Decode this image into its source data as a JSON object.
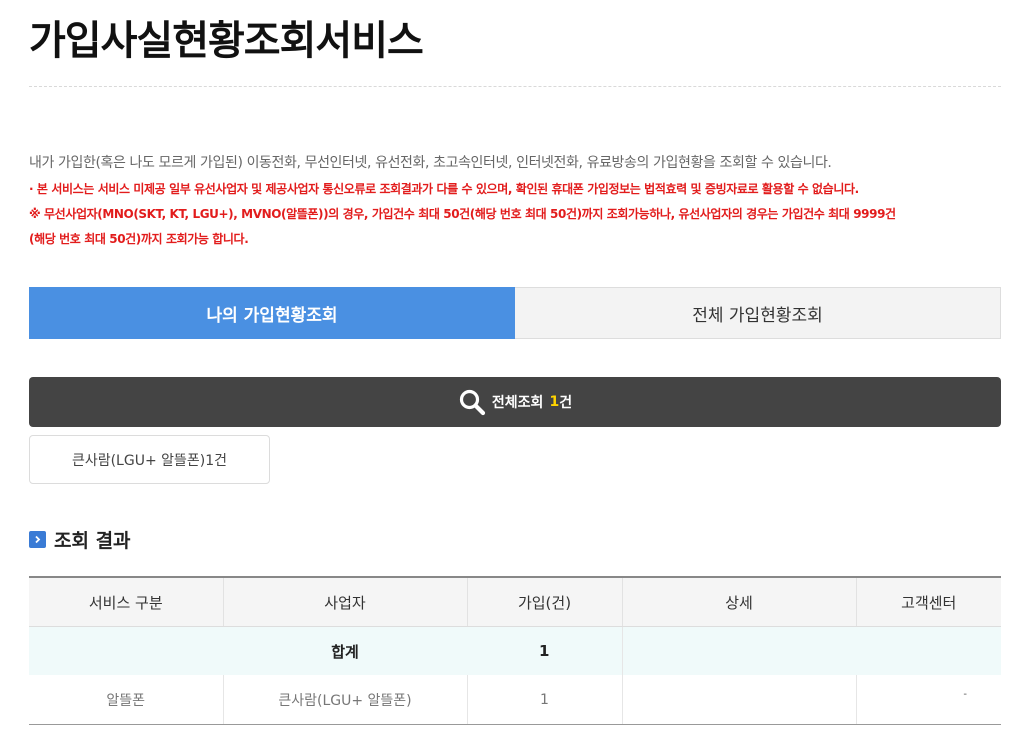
{
  "page": {
    "title": "가입사실현황조회서비스"
  },
  "intro": {
    "description": "내가 가입한(혹은 나도 모르게 가입된) 이동전화, 무선인터넷, 유선전화, 초고속인터넷, 인터넷전화, 유료방송의 가입현황을 조회할 수 있습니다.",
    "notice_1": "· 본 서비스는 서비스 미제공 일부 유선사업자 및 제공사업자 통신오류로 조회결과가 다를 수 있으며, 확인된 휴대폰 가입정보는 법적효력 및 증빙자료로 활용할 수 없습니다.",
    "notice_2_line1": "※ 무선사업자(MNO(SKT, KT, LGU+), MVNO(알뜰폰))의 경우, 가입건수 최대 50건(해당 번호 최대 50건)까지 조회가능하나, 유선사업자의 경우는 가입건수 최대 9999건",
    "notice_2_line2": "(해당 번호 최대 50건)까지 조회가능 합니다."
  },
  "tabs": [
    {
      "label": "나의 가입현황조회",
      "active": true
    },
    {
      "label": "전체 가입현황조회",
      "active": false
    }
  ],
  "summary": {
    "label": "전체조회",
    "count": "1",
    "unit": "건",
    "icon": "search-icon"
  },
  "carrier_chip": {
    "label": "큰사람(LGU+ 알뜰폰)1건"
  },
  "results": {
    "heading": "조회 결과",
    "heading_icon": "chevron-right-icon",
    "columns": [
      "서비스 구분",
      "사업자",
      "가입(건)",
      "상세",
      "고객센터"
    ],
    "total": {
      "label": "합계",
      "count": "1"
    },
    "rows": [
      {
        "service": "알뜰폰",
        "carrier": "큰사람(LGU+ 알뜰폰)",
        "count": "1",
        "detail": "",
        "support": "-"
      }
    ]
  },
  "colors": {
    "active_tab": "#4a90e2",
    "summary_bar": "#444444",
    "count_highlight": "#ffd400",
    "notice_red": "#e21c1c",
    "total_row_bg": "#f0fafa"
  }
}
